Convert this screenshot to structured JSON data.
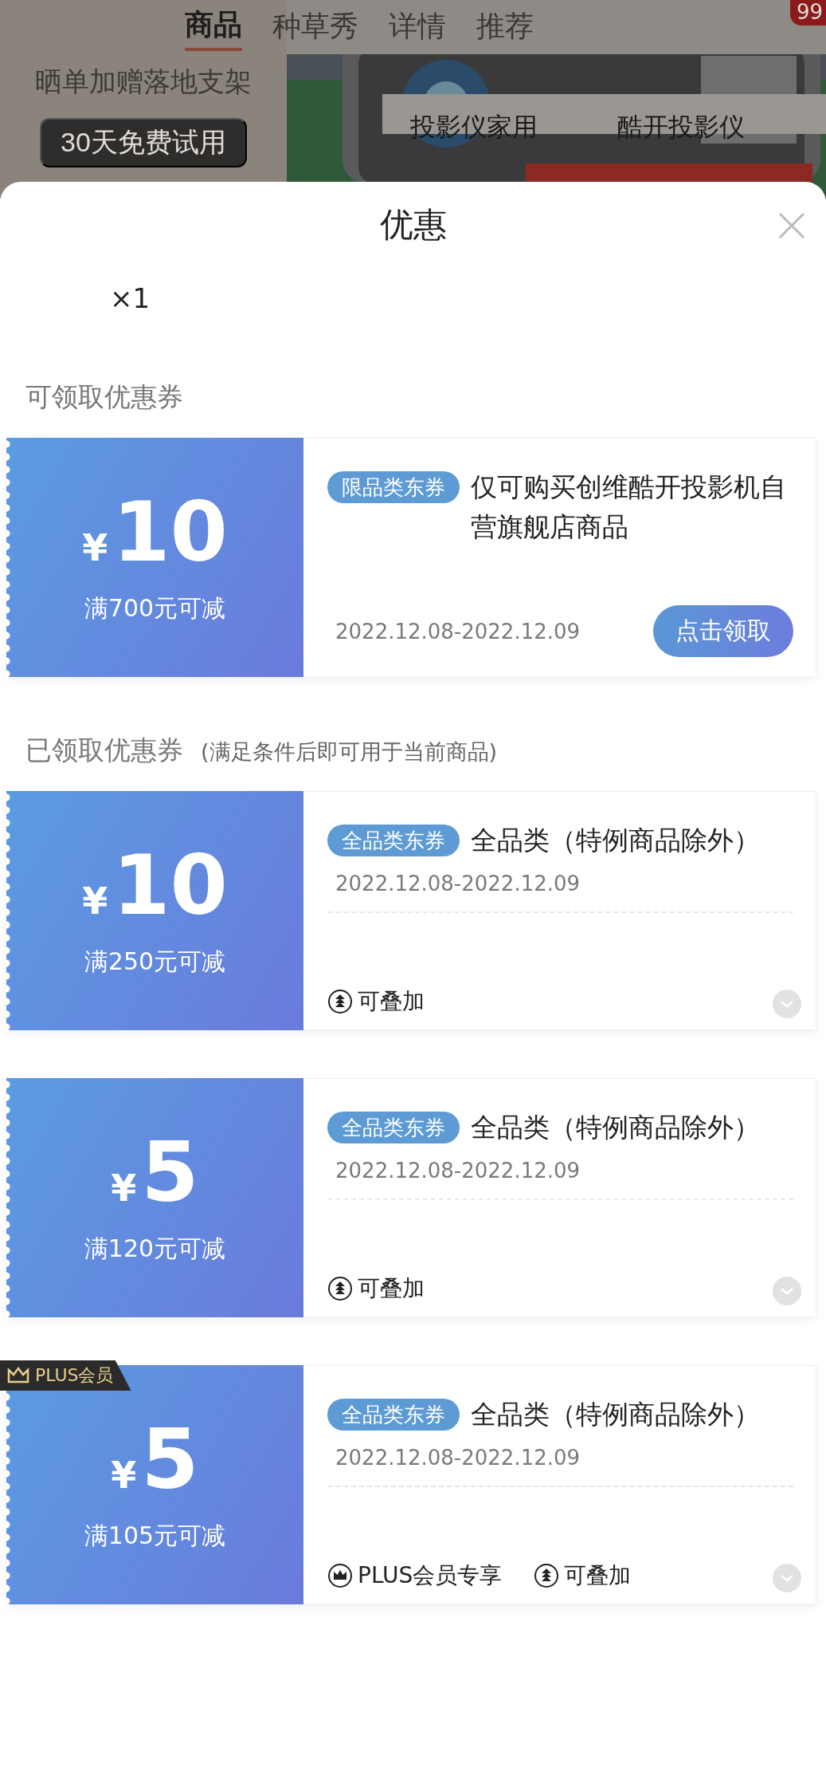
{
  "background": {
    "tabs": [
      {
        "label": "商品",
        "selected": true
      },
      {
        "label": "种草秀",
        "selected": false
      },
      {
        "label": "详情",
        "selected": false
      },
      {
        "label": "推荐",
        "selected": false
      }
    ],
    "promo_text": "晒单加赠落地支架",
    "trial_button": "30天免费试用",
    "search_terms": [
      "投影仪家用",
      "酷开投影仪"
    ],
    "cart_badge": "99"
  },
  "sheet": {
    "title": "优惠",
    "quantity": "×1",
    "sections": [
      {
        "title": "可领取优惠券",
        "coupons": [
          {
            "kind": "claimable",
            "currency": "¥",
            "amount": "10",
            "condition": "满700元可减",
            "tag": "限品类东券",
            "description": "仅可购买创维酷开投影机自营旗舰店商品",
            "validity": "2022.12.08-2022.12.09",
            "action": "点击领取"
          }
        ]
      },
      {
        "title": "已领取优惠券",
        "note": "(满足条件后即可用于当前商品)",
        "coupons": [
          {
            "kind": "claimed",
            "currency": "¥",
            "amount": "10",
            "condition": "满250元可减",
            "tag": "全品类东券",
            "description": "全品类（特例商品除外）",
            "validity": "2022.12.08-2022.12.09",
            "features": [
              {
                "kind": "stackable",
                "label": "可叠加"
              }
            ]
          },
          {
            "kind": "claimed",
            "currency": "¥",
            "amount": "5",
            "condition": "满120元可减",
            "tag": "全品类东券",
            "description": "全品类（特例商品除外）",
            "validity": "2022.12.08-2022.12.09",
            "features": [
              {
                "kind": "stackable",
                "label": "可叠加"
              }
            ]
          },
          {
            "kind": "claimed",
            "currency": "¥",
            "amount": "5",
            "condition": "满105元可减",
            "tag": "全品类东券",
            "description": "全品类（特例商品除外）",
            "validity": "2022.12.08-2022.12.09",
            "plus_badge": "PLUS会员",
            "features": [
              {
                "kind": "plus",
                "label": "PLUS会员专享"
              },
              {
                "kind": "stackable",
                "label": "可叠加"
              }
            ]
          }
        ]
      }
    ]
  }
}
